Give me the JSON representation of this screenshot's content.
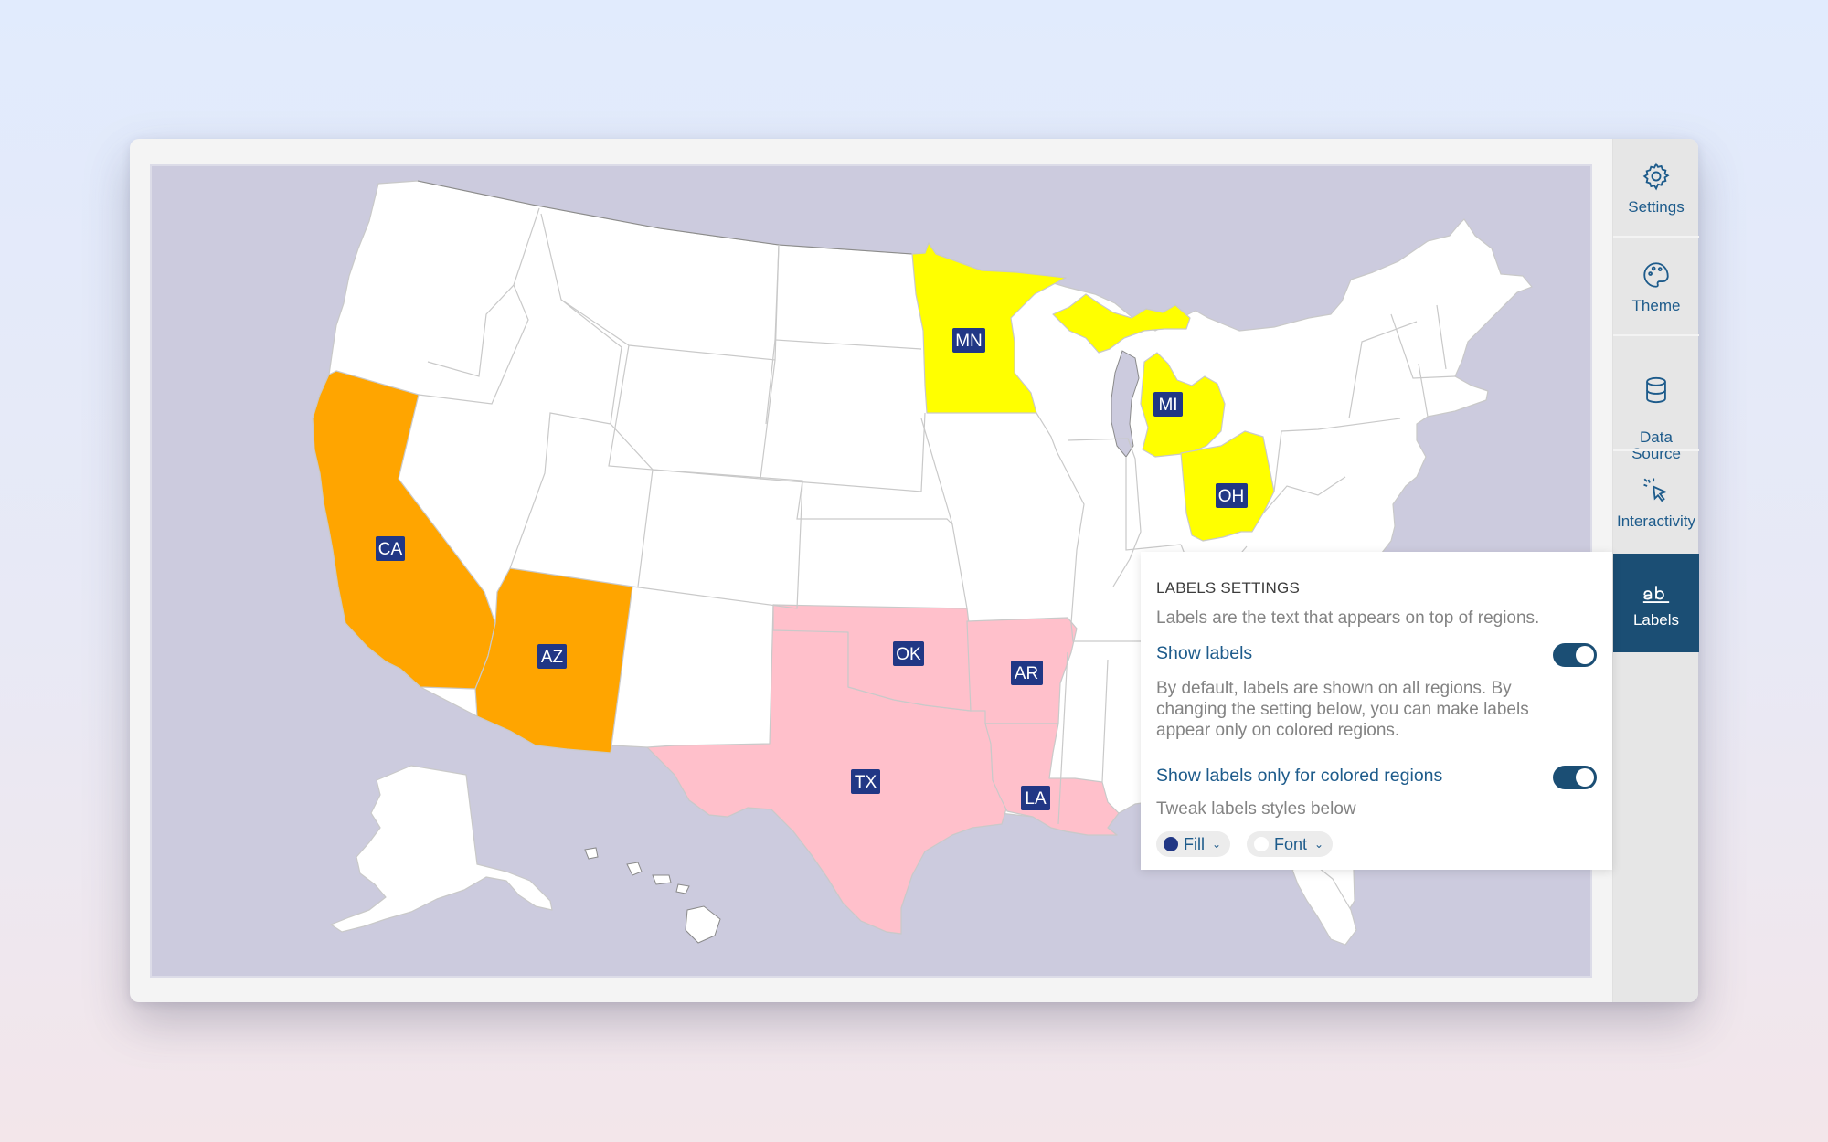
{
  "sidebar": {
    "items": [
      {
        "label": "Settings",
        "icon": "gear-icon"
      },
      {
        "label": "Theme",
        "icon": "palette-icon"
      },
      {
        "label": "Data\nSource",
        "icon": "database-icon"
      },
      {
        "label": "Interactivity",
        "icon": "pointer-click-icon"
      },
      {
        "label": "Labels",
        "icon": "text-label-icon",
        "active": true
      }
    ]
  },
  "panel": {
    "title": "LABELS SETTINGS",
    "description": "Labels are the text that appears on top of regions.",
    "show_labels": {
      "label": "Show labels",
      "enabled": true
    },
    "paragraph": "By default, labels are shown on all regions. By changing the setting below, you can make labels appear only on colored regions.",
    "show_colored_only": {
      "label": "Show labels only for colored regions",
      "enabled": true
    },
    "tweak_text": "Tweak labels styles below",
    "fill_pill": {
      "label": "Fill",
      "color": "#213785"
    },
    "font_pill": {
      "label": "Font",
      "color": "#ffffff"
    }
  },
  "map": {
    "background": "#cccbde",
    "default_fill": "#ffffff",
    "label_fill": "#213785",
    "label_text_color": "#ffffff",
    "regions": [
      {
        "code": "CA",
        "color": "#ffa500"
      },
      {
        "code": "AZ",
        "color": "#ffa500"
      },
      {
        "code": "MN",
        "color": "#ffff00"
      },
      {
        "code": "MI",
        "color": "#ffff00"
      },
      {
        "code": "OH",
        "color": "#ffff00"
      },
      {
        "code": "TX",
        "color": "#ffc0cb"
      },
      {
        "code": "OK",
        "color": "#ffc0cb"
      },
      {
        "code": "AR",
        "color": "#ffc0cb"
      },
      {
        "code": "LA",
        "color": "#ffc0cb"
      }
    ]
  }
}
